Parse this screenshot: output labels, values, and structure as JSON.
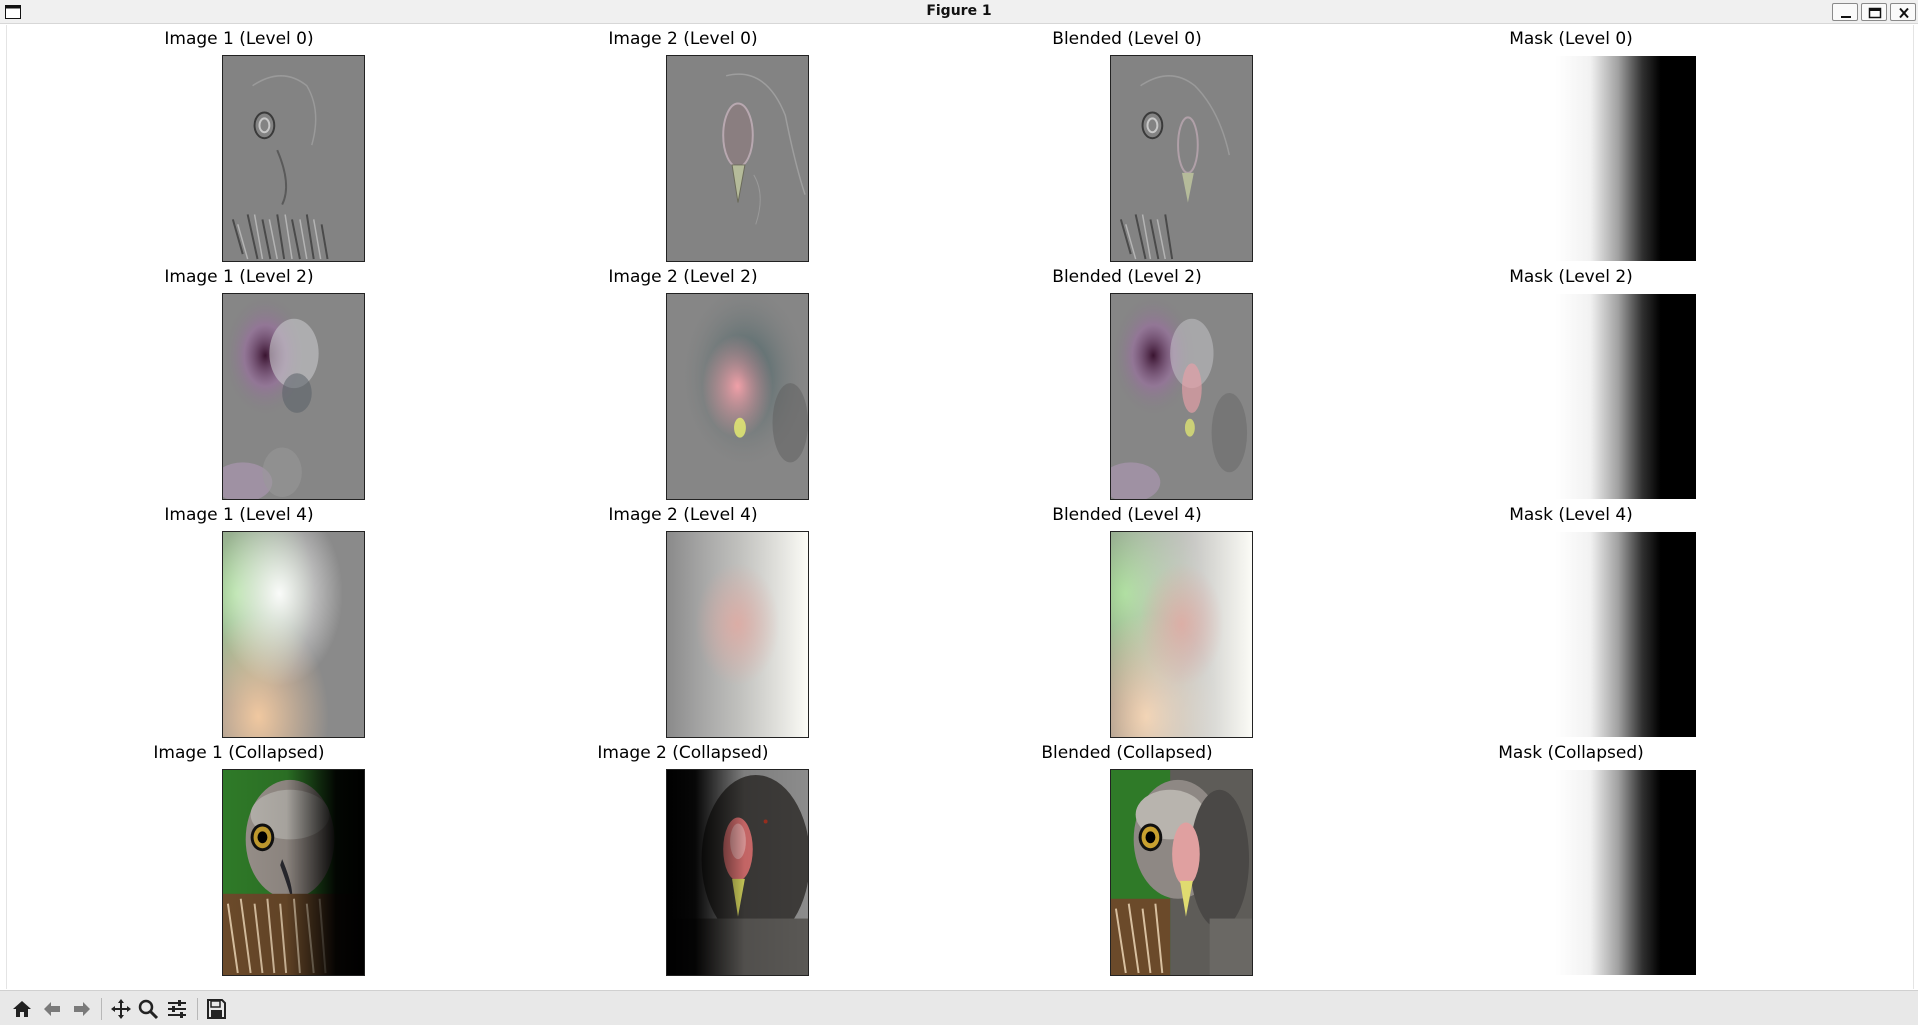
{
  "window": {
    "title": "Figure 1"
  },
  "icons": {
    "app": "window-icon",
    "minimize": "minimize-icon",
    "maximize": "maximize-icon",
    "close": "close-icon"
  },
  "figure": {
    "rows": [
      {
        "titles": [
          "Image 1 (Level 0)",
          "Image 2 (Level 0)",
          "Blended (Level 0)",
          "Mask (Level 0)"
        ]
      },
      {
        "titles": [
          "Image 1 (Level 2)",
          "Image 2 (Level 2)",
          "Blended (Level 2)",
          "Mask (Level 2)"
        ]
      },
      {
        "titles": [
          "Image 1 (Level 4)",
          "Image 2 (Level 4)",
          "Blended (Level 4)",
          "Mask (Level 4)"
        ]
      },
      {
        "titles": [
          "Image 1 (Collapsed)",
          "Image 2 (Collapsed)",
          "Blended (Collapsed)",
          "Mask (Collapsed)"
        ]
      }
    ]
  },
  "toolbar": {
    "tools": [
      "home-icon",
      "back-arrow-icon",
      "forward-arrow-icon",
      "pan-icon",
      "zoom-icon",
      "configure-subplots-icon",
      "save-icon"
    ]
  },
  "colors": {
    "laplacian_gray": "#808080",
    "green_background": "#2f7a28",
    "mask_white": "#ffffff",
    "mask_black": "#000000"
  }
}
